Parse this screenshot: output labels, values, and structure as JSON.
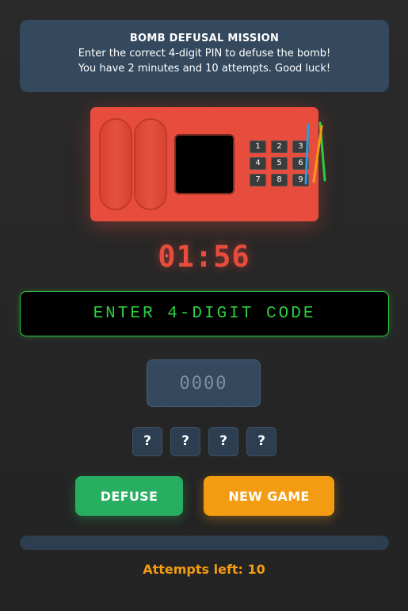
{
  "mission": {
    "title": "BOMB DEFUSAL MISSION",
    "line1": "Enter the correct 4-digit PIN to defuse the bomb!",
    "line2": "You have 2 minutes and 10 attempts. Good luck!"
  },
  "bomb": {
    "keys": [
      "1",
      "2",
      "3",
      "4",
      "5",
      "6",
      "7",
      "8",
      "9"
    ],
    "wire_colors": [
      "#3498db",
      "#2ecc40",
      "#f39c12",
      "#e74c3c"
    ]
  },
  "timer": "01:56",
  "code_display": "ENTER 4-DIGIT CODE",
  "pin_input": {
    "value": "",
    "placeholder": "0000"
  },
  "slots": [
    "?",
    "?",
    "?",
    "?"
  ],
  "buttons": {
    "defuse": "DEFUSE",
    "new_game": "NEW GAME"
  },
  "progress": {
    "fraction": 0
  },
  "attempts": "Attempts left: 10",
  "colors": {
    "accent_red": "#e74c3c",
    "accent_green": "#27ae60",
    "accent_orange": "#f39c12",
    "terminal_green": "#2ecc40",
    "panel_blue": "#34495e"
  }
}
